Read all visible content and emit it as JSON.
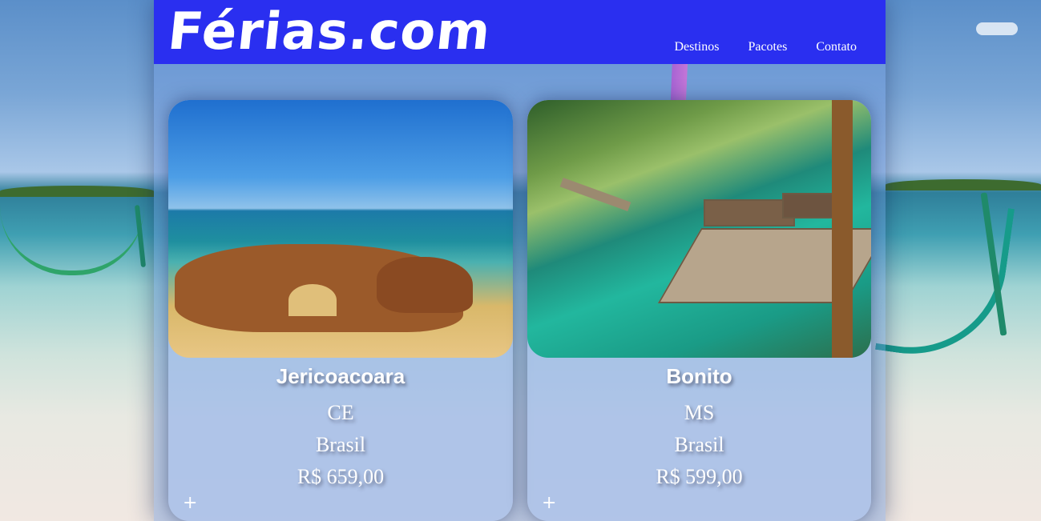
{
  "header": {
    "logo": "Férias.com",
    "nav": [
      "Destinos",
      "Pacotes",
      "Contato"
    ]
  },
  "cards": [
    {
      "name": "Jericoacoara",
      "state": "CE",
      "country": "Brasil",
      "price": "R$ 659,00",
      "more": "+"
    },
    {
      "name": "Bonito",
      "state": "MS",
      "country": "Brasil",
      "price": "R$ 599,00",
      "more": "+"
    }
  ],
  "colors": {
    "header_bg": "#2a2ff0",
    "text": "#ffffff"
  }
}
